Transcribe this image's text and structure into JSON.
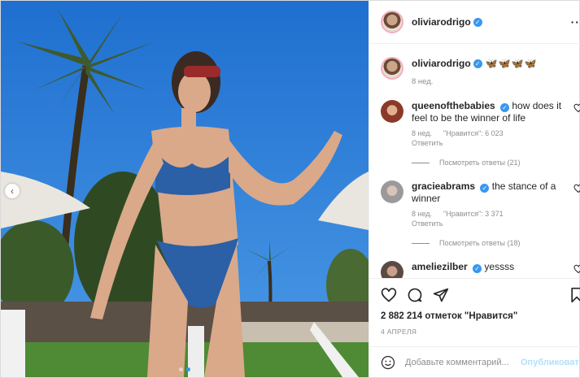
{
  "post": {
    "author": "oliviarodrigo",
    "verified_icon": "verified-badge-icon",
    "more_icon": "more-options-icon"
  },
  "caption": {
    "author": "oliviarodrigo",
    "emoji": "🦋🦋🦋🦋",
    "age": "8 нед."
  },
  "comments": [
    {
      "user": "queenofthebabies",
      "text": "how does it feel to be the winner of life",
      "age": "8 нед.",
      "likes": "\"Нравится\": 6 023",
      "reply": "Ответить",
      "view_replies": "Посмотреть ответы (21)",
      "avatar_color": "#8b3a2a"
    },
    {
      "user": "gracieabrams",
      "text": "the stance of a winner",
      "age": "8 нед.",
      "likes": "\"Нравится\": 3 371",
      "reply": "Ответить",
      "view_replies": "Посмотреть ответы (18)",
      "avatar_color": "#b9b9b9"
    },
    {
      "user": "ameliezilber",
      "text": "yessss",
      "avatar_color": "#5a4a44"
    }
  ],
  "actions": {
    "likes_text": "2 882 214 отметок \"Нравится\"",
    "date": "4 АПРЕЛЯ"
  },
  "composer": {
    "placeholder": "Добавьте комментарий...",
    "publish_label": "Опубликовать"
  },
  "colors": {
    "sky": "#2f7fd8",
    "accent": "#3897f0",
    "muted": "#8e8e8e"
  }
}
